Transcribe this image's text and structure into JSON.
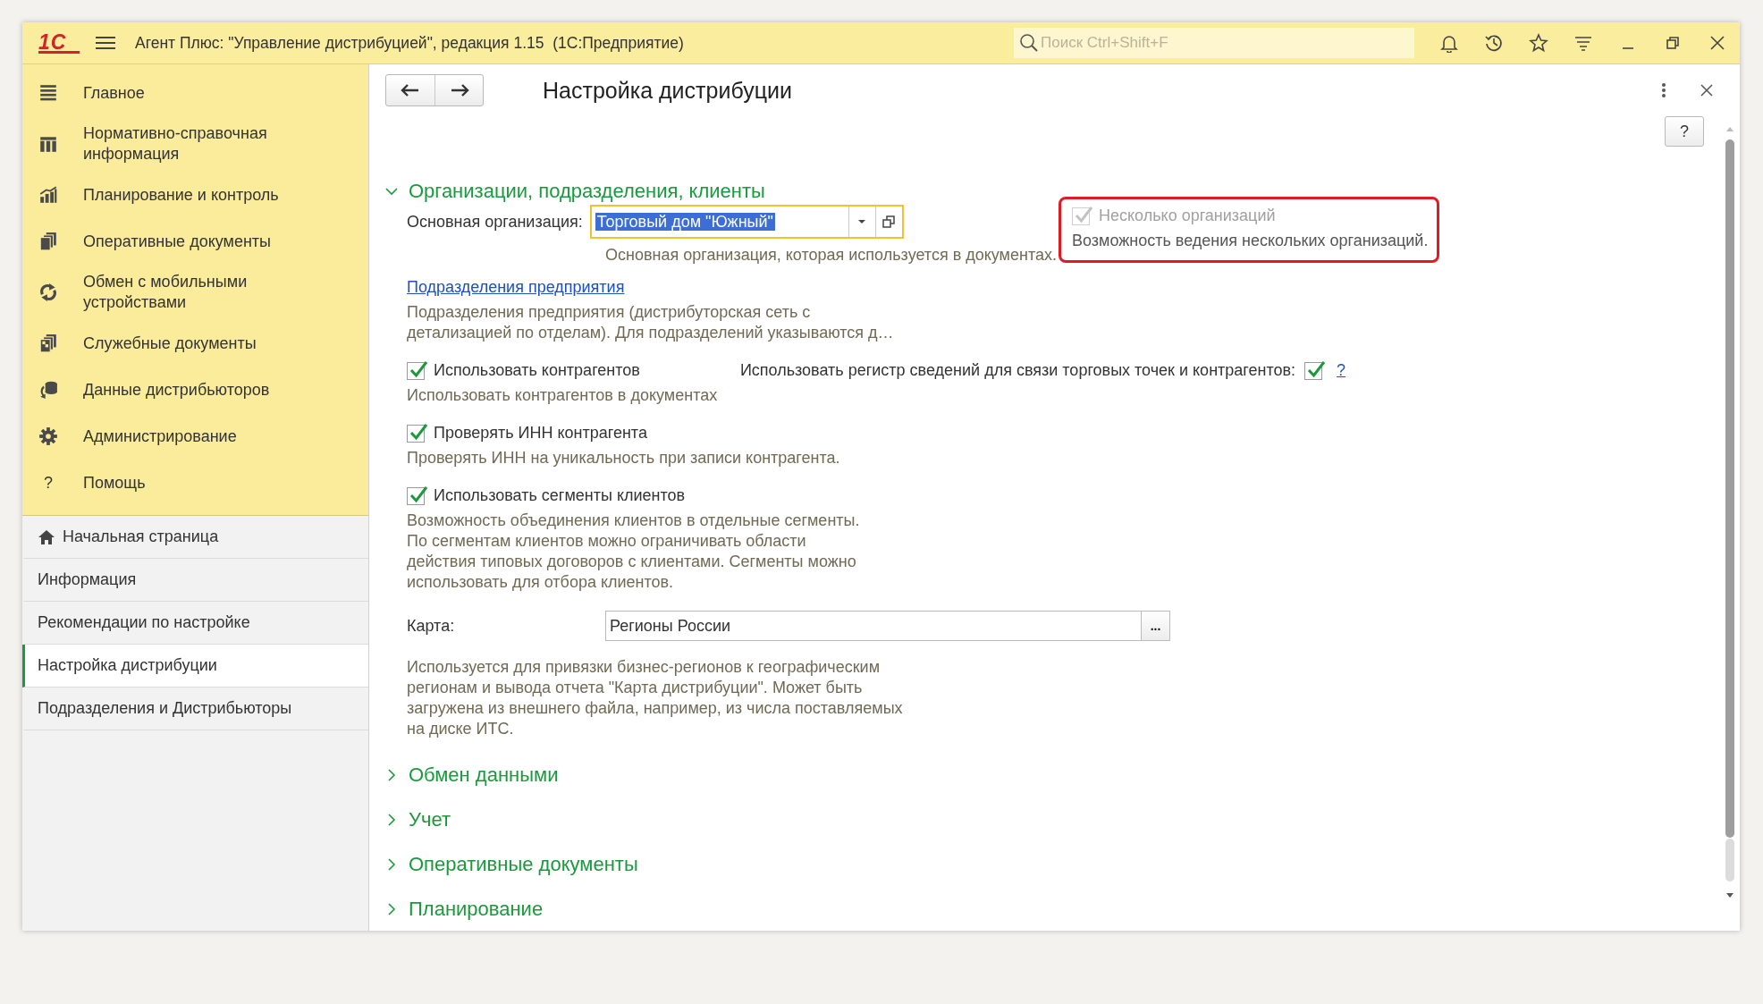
{
  "window": {
    "logo": "1С",
    "title": "Агент Плюс: \"Управление дистрибуцией\", редакция 1.15  (1С:Предприятие)",
    "search": {
      "placeholder": "Поиск Ctrl+Shift+F"
    }
  },
  "sections": [
    {
      "kind": "menu",
      "label": "Главное"
    },
    {
      "kind": "catalog",
      "label": "Нормативно-справочная информация"
    },
    {
      "kind": "chart",
      "label": "Планирование и контроль"
    },
    {
      "kind": "documents",
      "label": "Оперативные документы"
    },
    {
      "kind": "sync",
      "label": "Обмен с мобильными устройствами"
    },
    {
      "kind": "service",
      "label": "Служебные документы"
    },
    {
      "kind": "data",
      "label": "Данные дистрибьюторов"
    },
    {
      "kind": "gear",
      "label": "Администрирование"
    },
    {
      "kind": "help",
      "icon_text": "?",
      "label": "Помощь"
    }
  ],
  "nav_items": [
    {
      "kind": "home",
      "label": "Начальная страница",
      "selected": false
    },
    {
      "kind": "plain",
      "label": "Информация",
      "selected": false
    },
    {
      "kind": "plain",
      "label": "Рекомендации по настройке",
      "selected": false
    },
    {
      "kind": "plain",
      "label": "Настройка дистрибуции",
      "selected": true
    },
    {
      "kind": "plain",
      "label": "Подразделения и Дистрибьюторы",
      "selected": false
    }
  ],
  "form": {
    "title": "Настройка дистрибуции",
    "help_button": "?"
  },
  "groups": [
    {
      "title": "Организации, подразделения, клиенты",
      "expanded": true
    },
    {
      "title": "Обмен данными",
      "expanded": false
    },
    {
      "title": "Учет",
      "expanded": false
    },
    {
      "title": "Оперативные документы",
      "expanded": false
    },
    {
      "title": "Планирование",
      "expanded": false
    }
  ],
  "organization": {
    "label": "Основная организация:",
    "value": "Торговый дом \"Южный\"",
    "focused": true,
    "hint": "Основная организация, которая используется в документах."
  },
  "multiple_orgs": {
    "label": "Несколько организаций",
    "checked": true,
    "disabled": true,
    "highlighted": true,
    "hint": "Возможность ведения нескольких организаций."
  },
  "subdivisions": {
    "link": "Подразделения предприятия",
    "hint": "Подразделения предприятия (дистрибуторская сеть с детализацией по отделам). Для подразделений указываются д…"
  },
  "options": [
    {
      "label": "Использовать контрагентов",
      "checked": true,
      "hint": "Использовать контрагентов в документах",
      "side_option": {
        "label": "Использовать регистр сведений для связи торговых точек и контрагентов:",
        "checked": true,
        "help": "?"
      }
    },
    {
      "label": "Проверять ИНН контрагента",
      "checked": true,
      "hint": "Проверять ИНН на уникальность при записи контрагента."
    },
    {
      "label": "Использовать сегменты клиентов",
      "checked": true,
      "hint": "Возможность объединения клиентов в отдельные сегменты. По сегментам клиентов можно ограничивать области действия типовых договоров с клиентами. Сегменты можно использовать для отбора клиентов."
    }
  ],
  "map": {
    "label": "Карта:",
    "value": "Регионы России",
    "button": "...",
    "hint": "Используется для привязки бизнес-регионов к географическим регионам и вывода отчета \"Карта дистрибуции\". Может быть загружена из внешнего файла, например, из числа поставляемых на диске ИТС."
  }
}
